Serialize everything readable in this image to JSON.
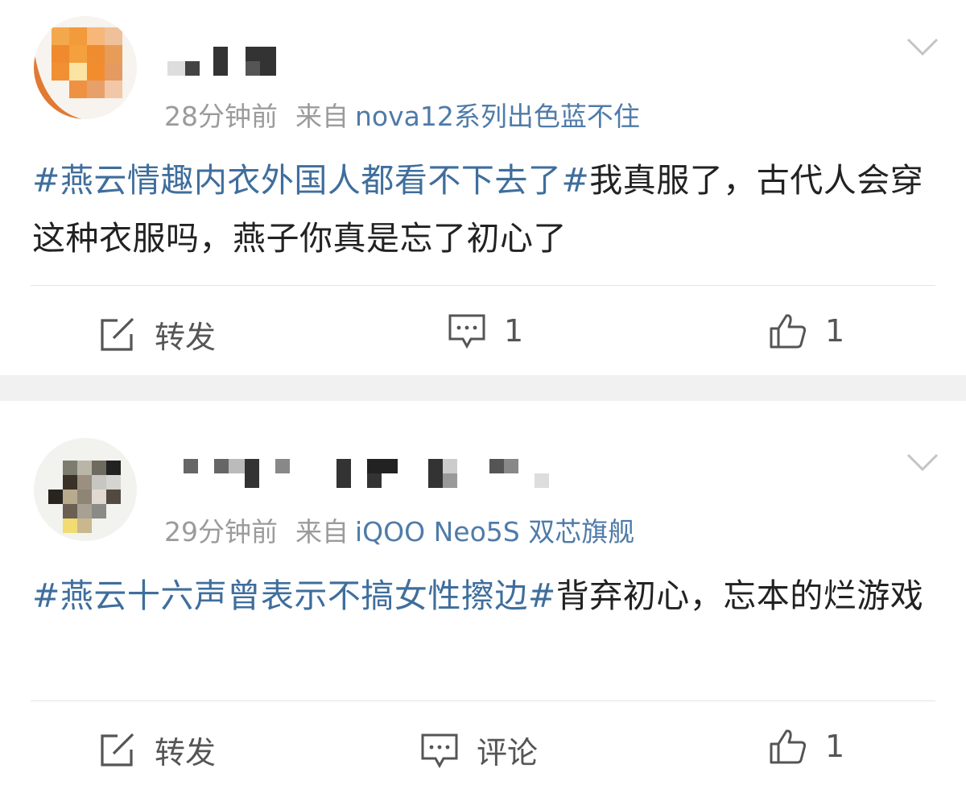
{
  "posts": [
    {
      "time": "28分钟前",
      "source_prefix": "来自",
      "device": "nova12系列出色蓝不住",
      "hashtag": "#燕云情趣内衣外国人都看不下去了#",
      "text": "我真服了，古代人会穿这种衣服吗，燕子你真是忘了初心了",
      "actions": {
        "repost": "转发",
        "comment": "1",
        "like": "1"
      }
    },
    {
      "time": "29分钟前",
      "source_prefix": "来自",
      "device": "iQOO Neo5S 双芯旗舰",
      "hashtag": "#燕云十六声曾表示不搞女性擦边#",
      "text": "背弃初心，忘本的烂游戏",
      "actions": {
        "repost": "转发",
        "comment": "评论",
        "like": "1"
      }
    }
  ],
  "icons": {
    "repost": "edit-square-icon",
    "comment": "comment-bubble-icon",
    "like": "thumbs-up-icon",
    "more": "chevron-down-icon"
  },
  "colors": {
    "link": "#3f6e9c",
    "meta": "#9b9b9b",
    "text": "#222222"
  }
}
